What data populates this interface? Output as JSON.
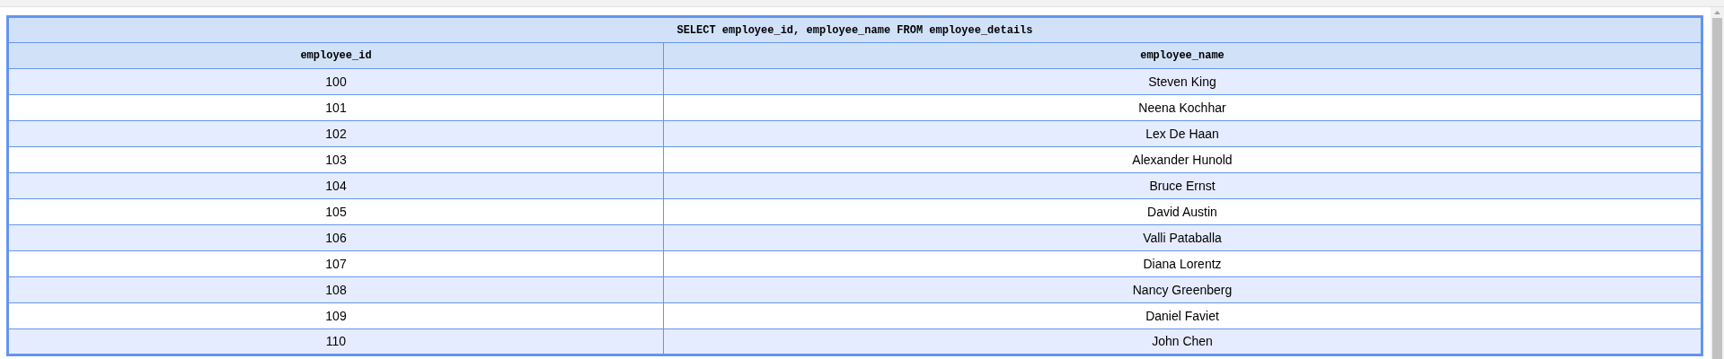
{
  "table": {
    "caption": "SELECT employee_id, employee_name FROM employee_details",
    "columns": [
      "employee_id",
      "employee_name"
    ],
    "rows": [
      [
        "100",
        "Steven King"
      ],
      [
        "101",
        "Neena Kochhar"
      ],
      [
        "102",
        "Lex De Haan"
      ],
      [
        "103",
        "Alexander Hunold"
      ],
      [
        "104",
        "Bruce Ernst"
      ],
      [
        "105",
        "David Austin"
      ],
      [
        "106",
        "Valli Pataballa"
      ],
      [
        "107",
        "Diana Lorentz"
      ],
      [
        "108",
        "Nancy Greenberg"
      ],
      [
        "109",
        "Daniel Faviet"
      ],
      [
        "110",
        "John Chen"
      ]
    ]
  }
}
